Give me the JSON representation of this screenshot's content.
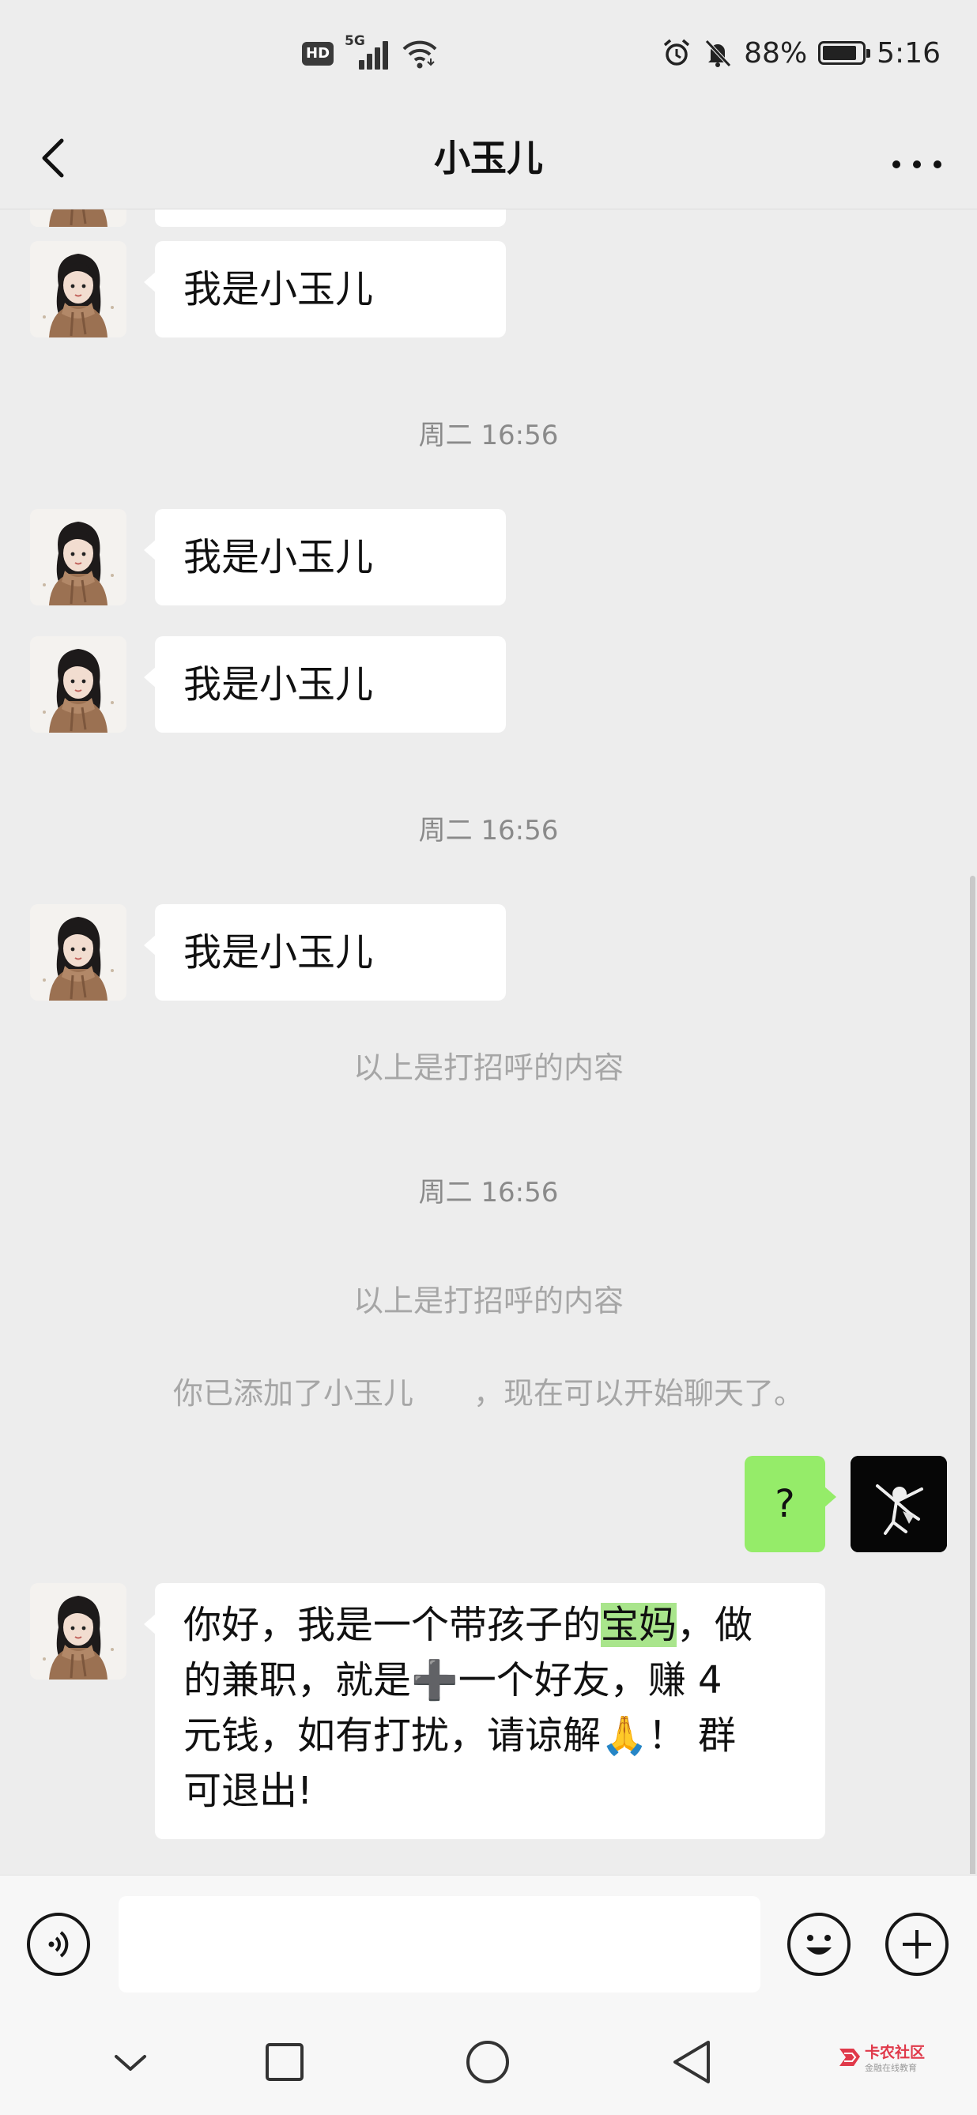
{
  "status_bar": {
    "hd_badge": "HD",
    "network": "5G",
    "battery_text": "88%",
    "battery_level": 0.88,
    "time": "5:16"
  },
  "header": {
    "title": "小玉儿"
  },
  "messages": [
    {
      "type": "received",
      "text": "我是小玉儿"
    },
    {
      "type": "time",
      "text": "周二 16:56"
    },
    {
      "type": "received",
      "text": "我是小玉儿"
    },
    {
      "type": "received",
      "text": "我是小玉儿"
    },
    {
      "type": "time",
      "text": "周二 16:56"
    },
    {
      "type": "received",
      "text": "我是小玉儿"
    },
    {
      "type": "system",
      "text": "以上是打招呼的内容"
    },
    {
      "type": "time",
      "text": "周二 16:56"
    },
    {
      "type": "system",
      "text": "以上是打招呼的内容"
    },
    {
      "type": "system",
      "text": "你已添加了小玉儿　　，现在可以开始聊天了。"
    },
    {
      "type": "sent",
      "text": "?"
    },
    {
      "type": "received",
      "lines": [
        [
          "你好，我是一个带孩子的",
          "宝妈",
          "，做"
        ],
        [
          "的兼职，就是➕一个好友，赚 4"
        ],
        [
          "元钱，如有打扰，请谅解🙏！ 群"
        ],
        [
          "可退出!"
        ]
      ]
    }
  ],
  "watermark": {
    "text": "卡农社区",
    "subtext": "金融在线教育"
  },
  "colors": {
    "background": "#ededed",
    "sent_bubble": "#95ec69",
    "received_bubble": "#ffffff",
    "highlight": "#a9e58c"
  }
}
